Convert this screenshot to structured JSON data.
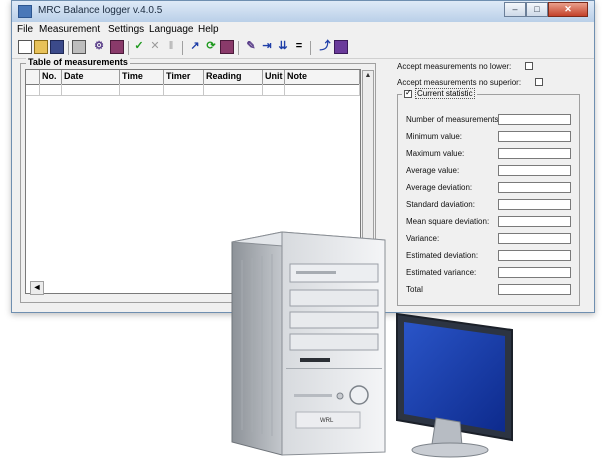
{
  "window": {
    "title": "MRC Balance logger v.4.0.5",
    "controls": {
      "minimize": "–",
      "maximize": "□",
      "close": "✕"
    }
  },
  "menu": [
    "File",
    "Measurement",
    "Settings",
    "Language",
    "Help"
  ],
  "toolbar": {
    "icons": [
      "new-document-icon",
      "open-folder-icon",
      "save-disk-icon",
      "print-icon",
      "tool-icon",
      "book-icon",
      "check-icon",
      "cancel-icon",
      "pause-icon",
      "sign-icon",
      "refresh-icon",
      "book-icon",
      "tool-icon",
      "arrow-right-icon",
      "arrow-down-icon",
      "equals-icon",
      "export-icon",
      "book-icon"
    ]
  },
  "table": {
    "group_title": "Table of measurements",
    "columns": [
      "No.",
      "Date",
      "Time",
      "Timer",
      "Reading",
      "Unit",
      "Note"
    ],
    "scroll_up": "▲",
    "scroll_left": "◄"
  },
  "options": {
    "no_lower": "Accept measurements no lower:",
    "no_superior": "Accept measurements no superior:"
  },
  "statistic": {
    "title": "Current statistic",
    "checked": true,
    "rows": [
      "Number of measurements:",
      "Minimum value:",
      "Maximum value:",
      "Average value:",
      "Average deviation:",
      "Standard daviation:",
      "Mean square deviation:",
      "Variance:",
      "Estimated deviation:",
      "Estimated variance:",
      "Total"
    ]
  },
  "pc": {
    "brand": "WRL"
  }
}
